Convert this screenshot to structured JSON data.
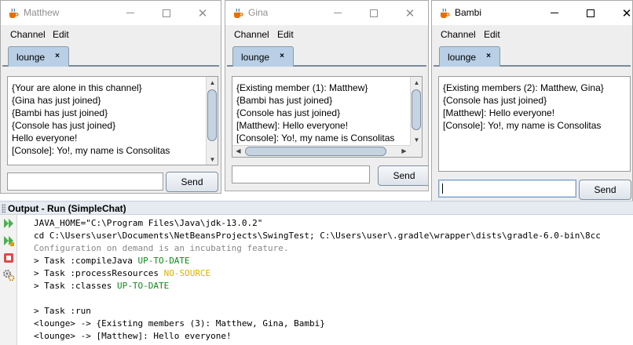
{
  "windows": [
    {
      "title": "Matthew",
      "menu": [
        "Channel",
        "Edit"
      ],
      "tab": "lounge",
      "tab_close": "×",
      "lines": [
        "{Your are alone in this channel}",
        "{Gina has just joined}",
        "{Bambi has just joined}",
        "{Console has just joined}",
        "Hello everyone!",
        "[Console]: Yo!, my name is Consolitas"
      ],
      "input_value": "",
      "send_label": "Send"
    },
    {
      "title": "Gina",
      "menu": [
        "Channel",
        "Edit"
      ],
      "tab": "lounge",
      "tab_close": "×",
      "lines": [
        "{Existing member (1): Matthew}",
        "{Bambi has just joined}",
        "{Console has just joined}",
        "[Matthew]: Hello everyone!",
        "[Console]: Yo!, my name is Consolitas"
      ],
      "input_value": "",
      "send_label": "Send"
    },
    {
      "title": "Bambi",
      "menu": [
        "Channel",
        "Edit"
      ],
      "tab": "lounge",
      "tab_close": "×",
      "lines": [
        "{Existing members (2): Matthew, Gina}",
        "{Console has just joined}",
        "[Matthew]: Hello everyone!",
        "[Console]: Yo!, my name is Consolitas"
      ],
      "input_value": "",
      "send_label": "Send"
    }
  ],
  "output": {
    "title": "Output - Run (SimpleChat)",
    "lines": [
      {
        "text": "JAVA_HOME=\"C:\\Program Files\\Java\\jdk-13.0.2\"",
        "style": "normal"
      },
      {
        "text": "cd C:\\Users\\user\\Documents\\NetBeansProjects\\SwingTest; C:\\Users\\user\\.gradle\\wrapper\\dists\\gradle-6.0-bin\\8cc",
        "style": "normal"
      },
      {
        "text": "Configuration on demand is an incubating feature.",
        "style": "gray"
      },
      {
        "prefix": "> Task :compileJava ",
        "status": "UP-TO-DATE",
        "status_style": "green"
      },
      {
        "prefix": "> Task :processResources ",
        "status": "NO-SOURCE",
        "status_style": "yellow"
      },
      {
        "prefix": "> Task :classes ",
        "status": "UP-TO-DATE",
        "status_style": "green"
      },
      {
        "text": "",
        "style": "normal"
      },
      {
        "text": "> Task :run",
        "style": "normal"
      },
      {
        "text": "<lounge> -> {Existing members (3): Matthew, Gina, Bambi}",
        "style": "normal"
      },
      {
        "text": "<lounge> -> [Matthew]: Hello everyone!",
        "style": "normal"
      }
    ]
  },
  "colors": {
    "tab_selected": "#b8cfe5",
    "task_ok": "#0f8a1a",
    "task_skip": "#d9b300",
    "config_text": "#888888"
  },
  "icons": [
    "java-cup-icon",
    "rerun-icon",
    "rerun-with-params-icon",
    "stop-icon",
    "settings-icon"
  ]
}
